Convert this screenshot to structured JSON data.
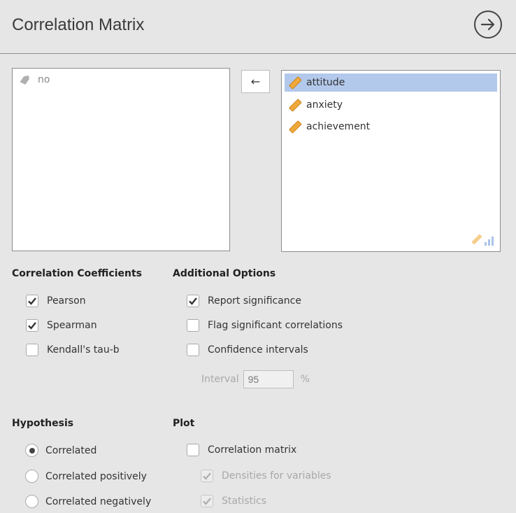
{
  "header": {
    "title": "Correlation Matrix"
  },
  "available_vars": [
    {
      "name": "no",
      "type": "nominal"
    }
  ],
  "move_button": {
    "label": "←"
  },
  "selected_vars": [
    {
      "name": "attitude",
      "selected": true
    },
    {
      "name": "anxiety",
      "selected": false
    },
    {
      "name": "achievement",
      "selected": false
    }
  ],
  "correlation_coefficients": {
    "label": "Correlation Coefficients",
    "options": [
      {
        "label": "Pearson",
        "checked": true
      },
      {
        "label": "Spearman",
        "checked": true
      },
      {
        "label": "Kendall's tau-b",
        "checked": false
      }
    ]
  },
  "additional_options": {
    "label": "Additional Options",
    "options": [
      {
        "label": "Report significance",
        "checked": true
      },
      {
        "label": "Flag significant correlations",
        "checked": false
      },
      {
        "label": "Confidence intervals",
        "checked": false
      }
    ],
    "interval": {
      "label": "Interval",
      "value": "95",
      "unit": "%"
    }
  },
  "hypothesis": {
    "label": "Hypothesis",
    "options": [
      {
        "label": "Correlated",
        "selected": true
      },
      {
        "label": "Correlated positively",
        "selected": false
      },
      {
        "label": "Correlated negatively",
        "selected": false
      }
    ]
  },
  "plot": {
    "label": "Plot",
    "options": [
      {
        "label": "Correlation matrix",
        "checked": false,
        "enabled": true
      },
      {
        "label": "Densities for variables",
        "checked": true,
        "enabled": false
      },
      {
        "label": "Statistics",
        "checked": true,
        "enabled": false
      }
    ]
  },
  "colors": {
    "selected_row": "#b3c9ec",
    "ruler_icon": "#f0a83a",
    "bar_icon": "#7fa6e0"
  }
}
